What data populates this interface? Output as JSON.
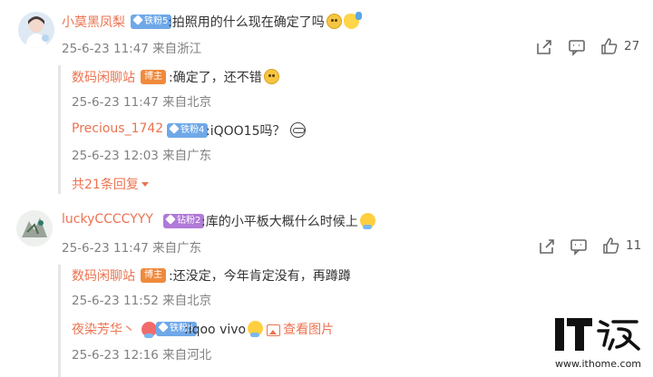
{
  "comments": [
    {
      "username": "小莫黑凤梨",
      "badge": "铁粉5",
      "text": ":拍照用的什么现在确定了吗",
      "meta": "25-6-23 11:47 来自浙江",
      "like_count": "27",
      "replies": [
        {
          "username": "数码闲聊站",
          "badge": "博主",
          "text": ":确定了，还不错",
          "meta": "25-6-23 11:47 来自北京"
        },
        {
          "username": "Precious_1742",
          "badge": "铁粉4",
          "text": ":iQOO15吗？",
          "meta": "25-6-23 12:03 来自广东"
        }
      ],
      "more_label": "共21条回复"
    },
    {
      "username": "luckyCCCCYYY",
      "badge": "钻粉2",
      "text": ":库的小平板大概什么时候上",
      "meta": "25-6-23 11:47 来自广东",
      "like_count": "11",
      "replies": [
        {
          "username": "数码闲聊站",
          "badge": "博主",
          "text": ":还没定，今年肯定没有，再蹲蹲",
          "meta": "25-6-23 11:52 来自北京"
        },
        {
          "username": "夜染芳华丶",
          "badge": "铁粉5",
          "text": ":iqoo vivo",
          "view_image_label": "查看图片",
          "meta": "25-6-23 12:16 来自河北"
        }
      ]
    }
  ],
  "watermark": {
    "logo_text": "IT之家",
    "url": "www.ithome.com"
  },
  "colors": {
    "accent": "#eb7350",
    "badge_fan": "#6fa8e8",
    "badge_author": "#f08a3c",
    "badge_diamond": "#b07ad8",
    "meta": "#808080"
  }
}
